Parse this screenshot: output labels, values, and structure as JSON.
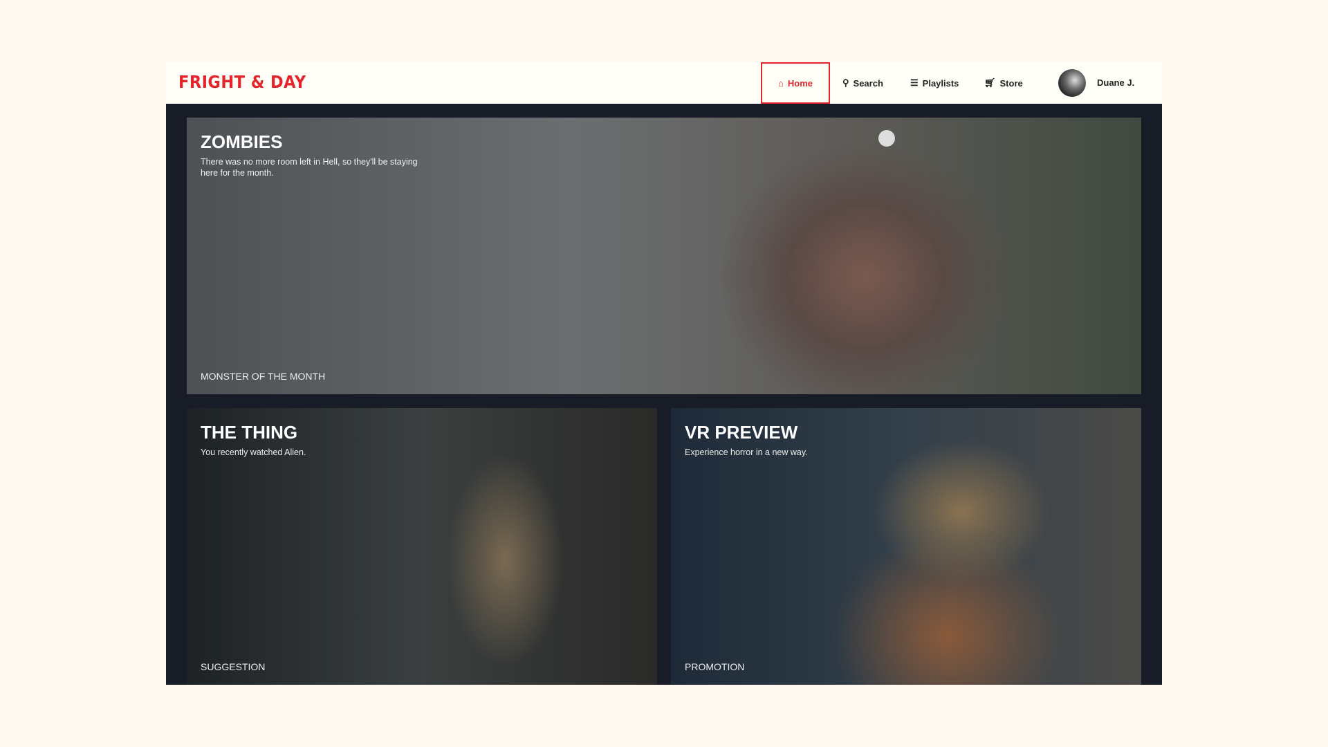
{
  "header": {
    "logo": "FRIGHT & DAY",
    "nav": [
      {
        "label": "Home",
        "icon": "home-icon"
      },
      {
        "label": "Search",
        "icon": "search-icon"
      },
      {
        "label": "Playlists",
        "icon": "list-icon"
      },
      {
        "label": "Store",
        "icon": "cart-icon"
      }
    ],
    "user": "Duane J.",
    "accent": "#e3262b"
  },
  "featured": {
    "title": "ZOMBIES",
    "description": "There was no more room left in Hell, so they'll be staying here for the month.",
    "tag": "MONSTER OF THE MONTH"
  },
  "cards": [
    {
      "title": "THE THING",
      "description": "You recently watched Alien.",
      "tag": "SUGGESTION"
    },
    {
      "title": "VR PREVIEW",
      "description": "Experience horror in a new way.",
      "tag": "PROMOTION"
    }
  ]
}
